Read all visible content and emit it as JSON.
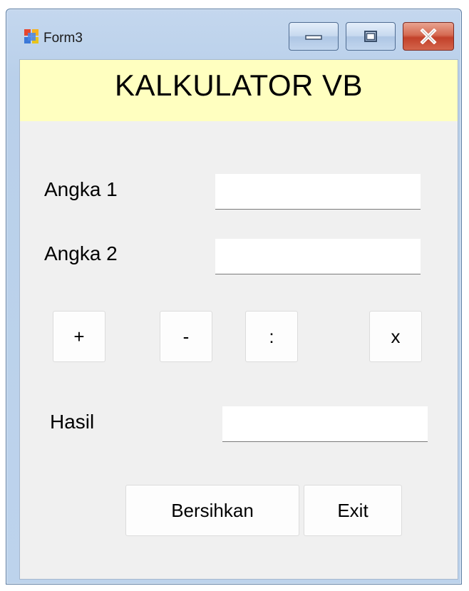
{
  "window": {
    "title": "Form3",
    "icon": "windows-form-icon",
    "controls": {
      "minimize_icon": "minimize-icon",
      "maximize_icon": "maximize-icon",
      "close_icon": "close-icon"
    },
    "colors": {
      "frame": "#b9d0ea",
      "close_button": "#c2412a"
    }
  },
  "header": {
    "title": "KALKULATOR VB",
    "background": "#ffffc0"
  },
  "form": {
    "angka1_label": "Angka 1",
    "angka1_value": "",
    "angka2_label": "Angka 2",
    "angka2_value": "",
    "hasil_label": "Hasil",
    "hasil_value": ""
  },
  "operators": {
    "add": "+",
    "subtract": "-",
    "divide": ":",
    "multiply": "x"
  },
  "actions": {
    "clear": "Bersihkan",
    "exit": "Exit"
  }
}
